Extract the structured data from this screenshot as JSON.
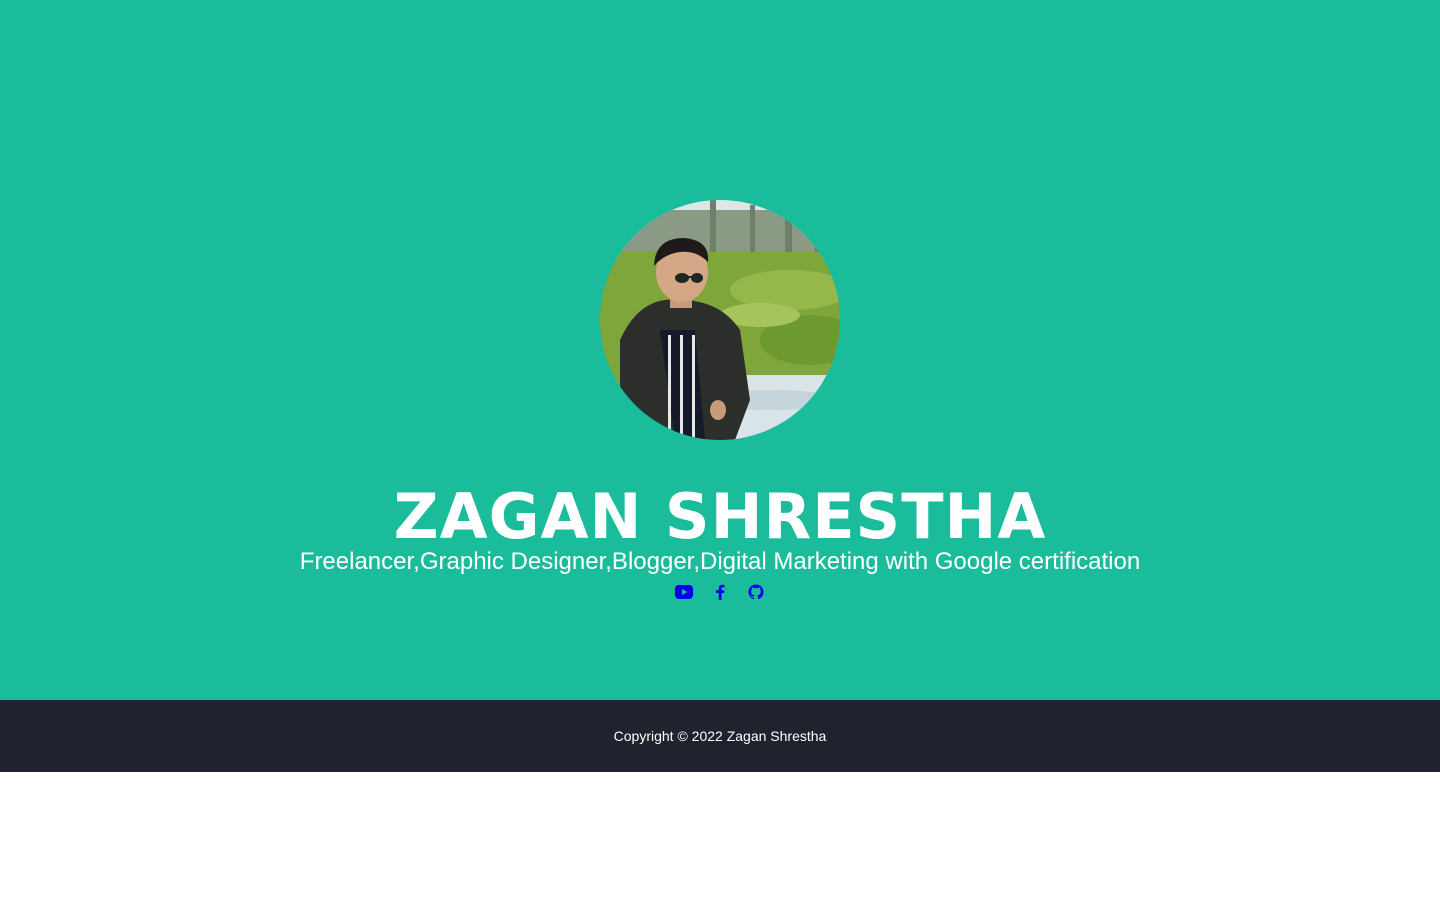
{
  "colors": {
    "hero_background": "#1abc9c",
    "footer_background": "#1e232d",
    "text": "#ffffff",
    "social_icon": "#0000ee"
  },
  "profile": {
    "avatar_icon": "profile-photo",
    "name": "ZAGAN SHRESTHA",
    "tagline": "Freelancer,Graphic Designer,Blogger,Digital Marketing with Google certification"
  },
  "social_links": [
    {
      "icon": "youtube-icon"
    },
    {
      "icon": "facebook-icon"
    },
    {
      "icon": "github-icon"
    }
  ],
  "footer": {
    "copyright": "Copyright © 2022 Zagan Shrestha"
  }
}
